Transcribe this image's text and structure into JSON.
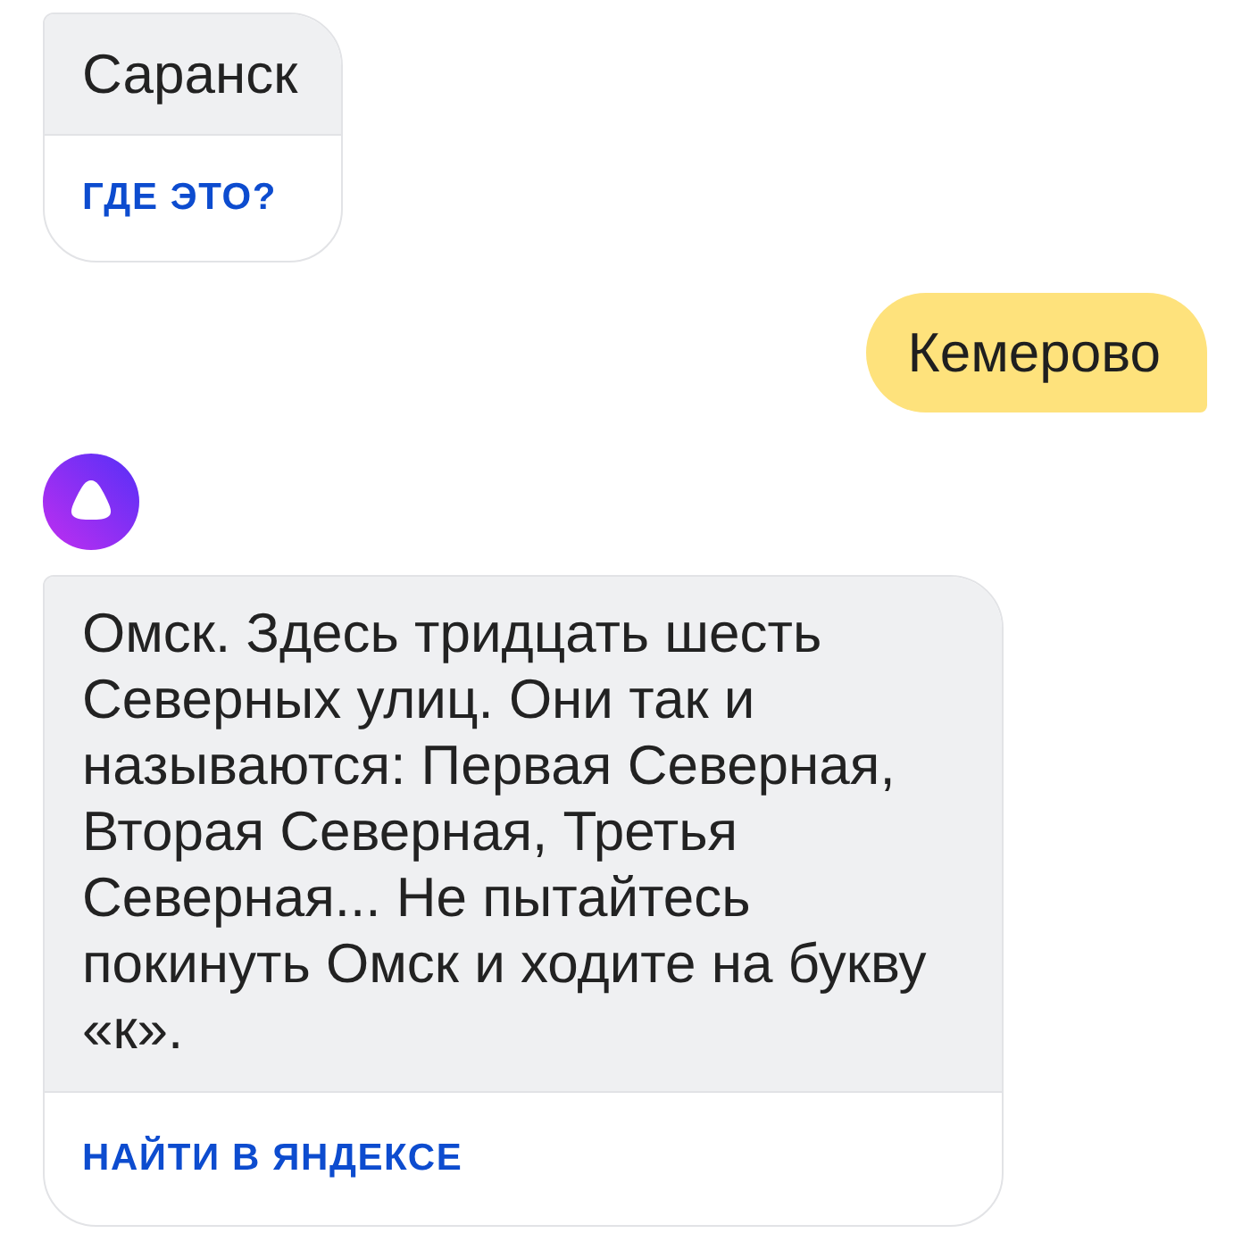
{
  "messages": [
    {
      "kind": "assistant",
      "avatar": false,
      "text": "Саранск",
      "action": "ГДЕ ЭТО?"
    },
    {
      "kind": "user",
      "text": "Кемерово"
    },
    {
      "kind": "assistant",
      "avatar": true,
      "text": "Омск. Здесь тридцать шесть Северных улиц. Они так и называются: Первая Северная, Вторая Северная, Третья Северная... Не пытайтесь покинуть Омск и ходите на букву «к».",
      "action": "НАЙТИ В ЯНДЕКСЕ"
    }
  ]
}
